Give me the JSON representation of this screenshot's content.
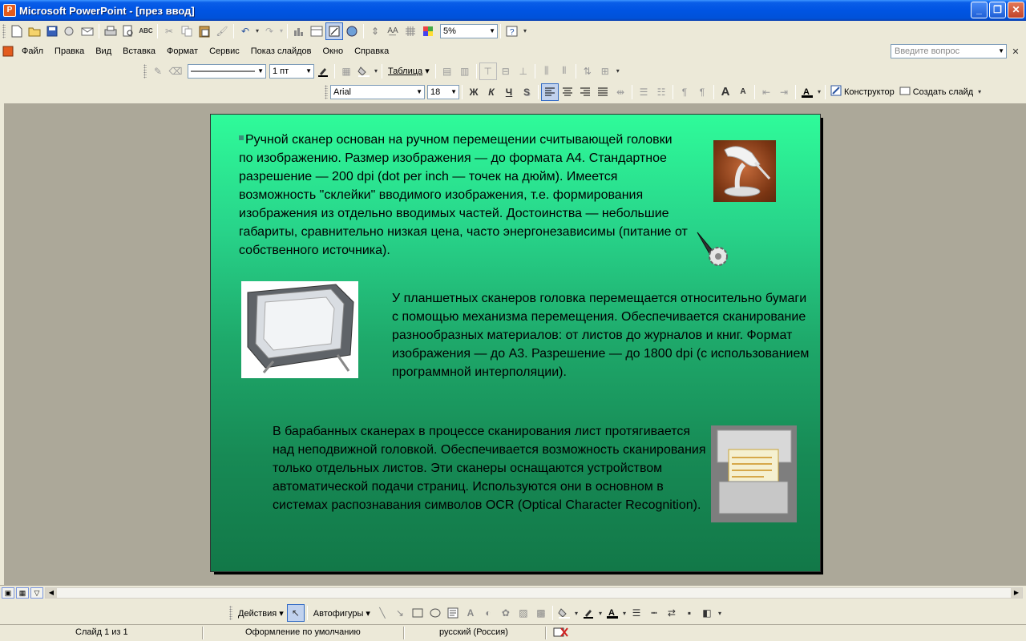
{
  "window": {
    "title": "Microsoft PowerPoint - [през ввод]",
    "minimize_glyph": "_",
    "restore_glyph": "❐",
    "close_glyph": "✕"
  },
  "standard_toolbar": {
    "zoom_value": "5%"
  },
  "menubar": {
    "items": [
      "Файл",
      "Правка",
      "Вид",
      "Вставка",
      "Формат",
      "Сервис",
      "Показ слайдов",
      "Окно",
      "Справка"
    ],
    "help_placeholder": "Введите вопрос"
  },
  "tables_toolbar": {
    "line_weight": "1 пт",
    "table_label": "Таблица"
  },
  "formatting_toolbar": {
    "font_name": "Arial",
    "font_size": "18",
    "bold": "Ж",
    "italic": "К",
    "underline": "Ч",
    "shadow": "S",
    "designer_label": "Конструктор",
    "new_slide_label": "Создать слайд"
  },
  "slide": {
    "paragraph1": "Ручной сканер основан на ручном перемещении считывающей головки по изображению. Размер изображения — до формата А4. Стандартное разрешение — 200 dpi (dot per inch — точек на дюйм). Имеется возможность \"склейки\" вводимого изображения, т.е. формирования изображения из отдельно вводимых частей. Достоинства — небольшие габариты, сравнительно низкая цена, часто энергонезависимы (питание от собственного источника).",
    "paragraph2": "У планшетных сканеров головка перемещается относительно бумаги с помощью механизма перемещения. Обеспечивается сканирование разнообразных материалов: от листов до журналов и книг. Формат изображения — до А3. Разрешение — до 1800 dpi (с использованием программной интерполяции).",
    "paragraph3": "В барабанных сканерах в процессе сканирования лист протягивается над неподвижной головкой. Обеспечивается возможность сканирования только отдельных листов. Эти сканеры оснащаются устройством автоматической подачи страниц. Используются они в основном в системах распознавания символов OCR (Optical Character Recognition)."
  },
  "drawing_toolbar": {
    "actions_label": "Действия",
    "autoshapes_label": "Автофигуры"
  },
  "statusbar": {
    "slide_info": "Слайд 1 из 1",
    "design": "Оформление по умолчанию",
    "language": "русский (Россия)"
  }
}
